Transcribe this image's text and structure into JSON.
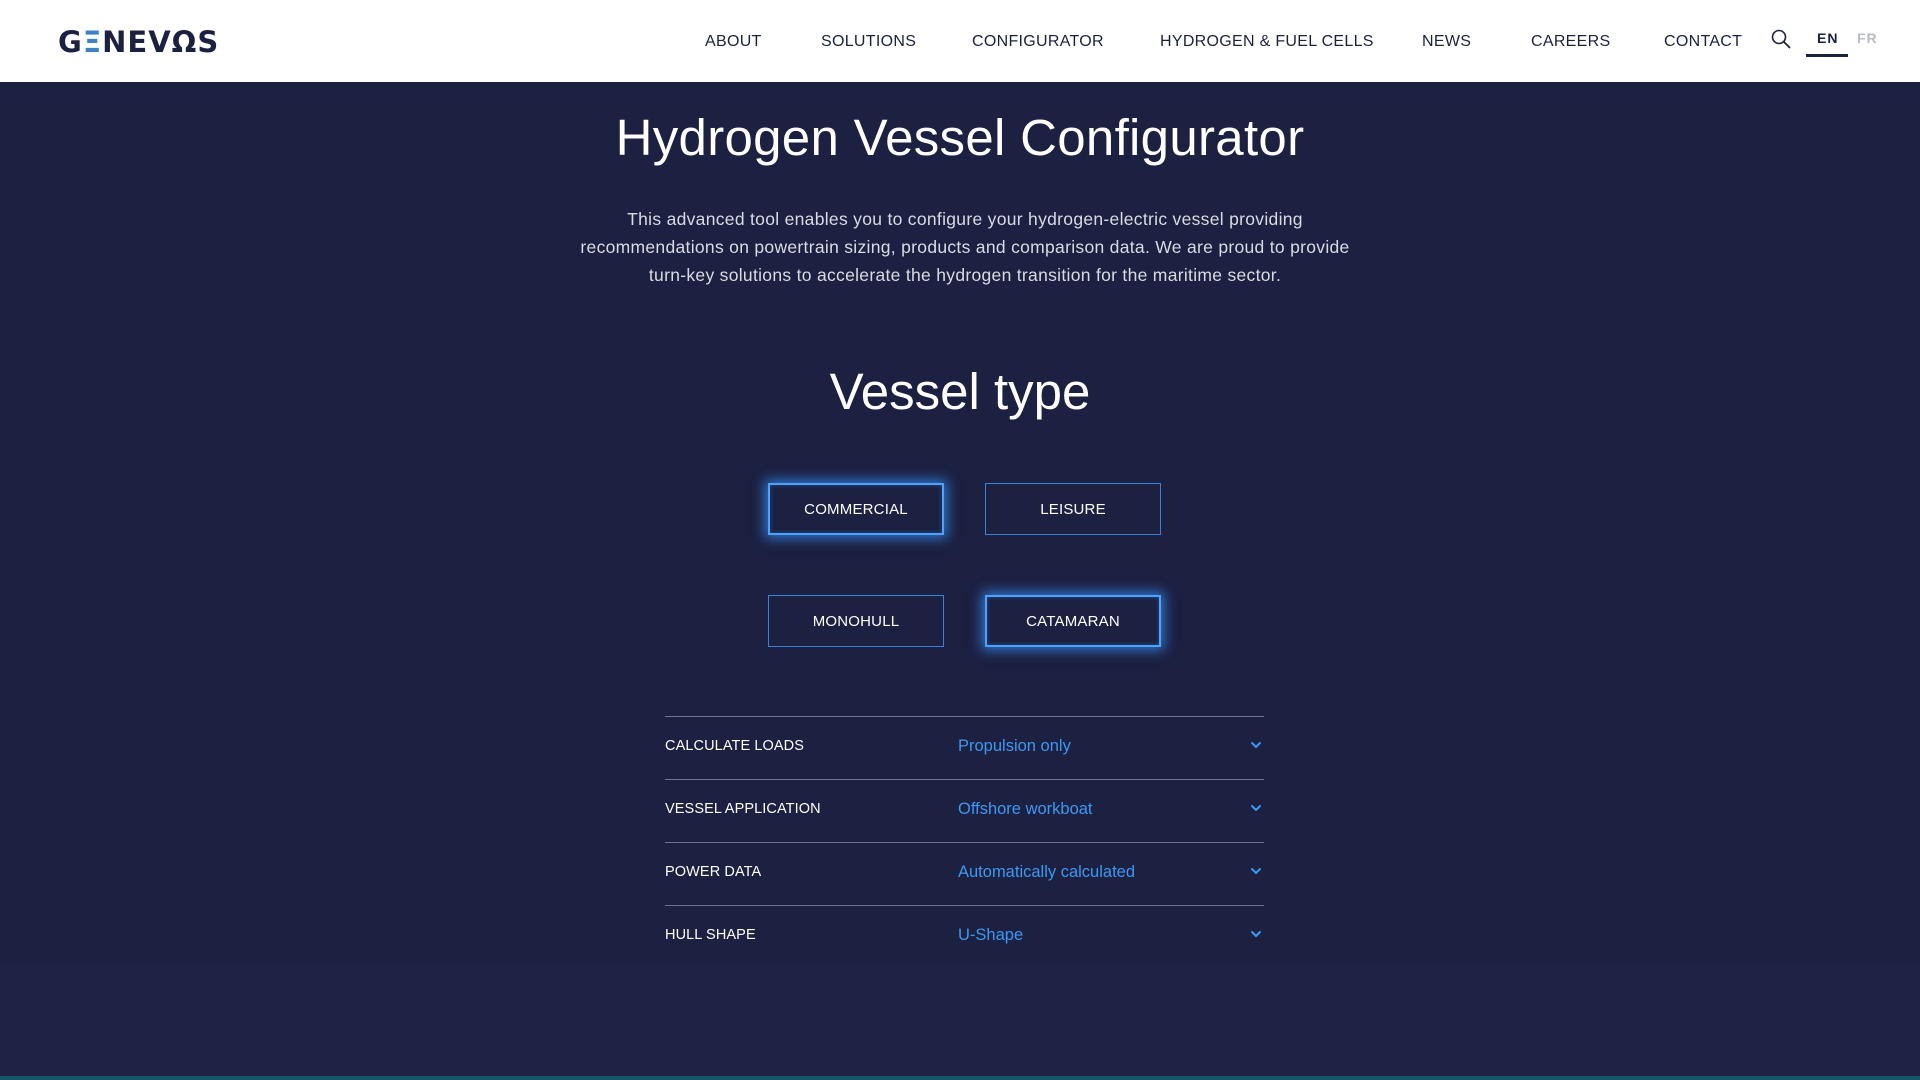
{
  "header": {
    "logo": {
      "text_pre": "G",
      "text_accent": "Ξ",
      "text_post": "NEVΩS",
      "alt": "GENEVOS"
    },
    "nav": [
      {
        "id": "about",
        "label": "ABOUT"
      },
      {
        "id": "solutions",
        "label": "SOLUTIONS"
      },
      {
        "id": "configurator",
        "label": "CONFIGURATOR"
      },
      {
        "id": "hydrogen",
        "label": "HYDROGEN & FUEL CELLS"
      },
      {
        "id": "news",
        "label": "NEWS"
      },
      {
        "id": "careers",
        "label": "CAREERS"
      },
      {
        "id": "contact",
        "label": "CONTACT"
      }
    ],
    "search_icon": "search-icon",
    "languages": {
      "active": "EN",
      "inactive": "FR"
    }
  },
  "main": {
    "title": "Hydrogen Vessel Configurator",
    "intro_lines": [
      "This advanced tool enables you to configure your hydrogen-electric vessel providing",
      "recommendations on powertrain sizing, products and comparison data. We are proud to provide",
      "turn-key solutions to accelerate the hydrogen transition for the maritime sector."
    ],
    "vessel_type": {
      "title": "Vessel type",
      "usage_options": [
        {
          "label": "COMMERCIAL",
          "selected": true
        },
        {
          "label": "LEISURE",
          "selected": false
        }
      ],
      "hull_options": [
        {
          "label": "MONOHULL",
          "selected": false
        },
        {
          "label": "CATAMARAN",
          "selected": true
        }
      ]
    },
    "settings": [
      {
        "label": "CALCULATE LOADS",
        "value": "Propulsion only"
      },
      {
        "label": "VESSEL APPLICATION",
        "value": "Offshore workboat"
      },
      {
        "label": "POWER DATA",
        "value": "Automatically calculated"
      },
      {
        "label": "HULL SHAPE",
        "value": "U-Shape"
      }
    ]
  },
  "colors": {
    "background": "#1c2041",
    "header_bg": "#ffffff",
    "accent_blue": "#3d98f2",
    "button_border": "#3b82d6",
    "button_glow": "#4aa3ff"
  }
}
